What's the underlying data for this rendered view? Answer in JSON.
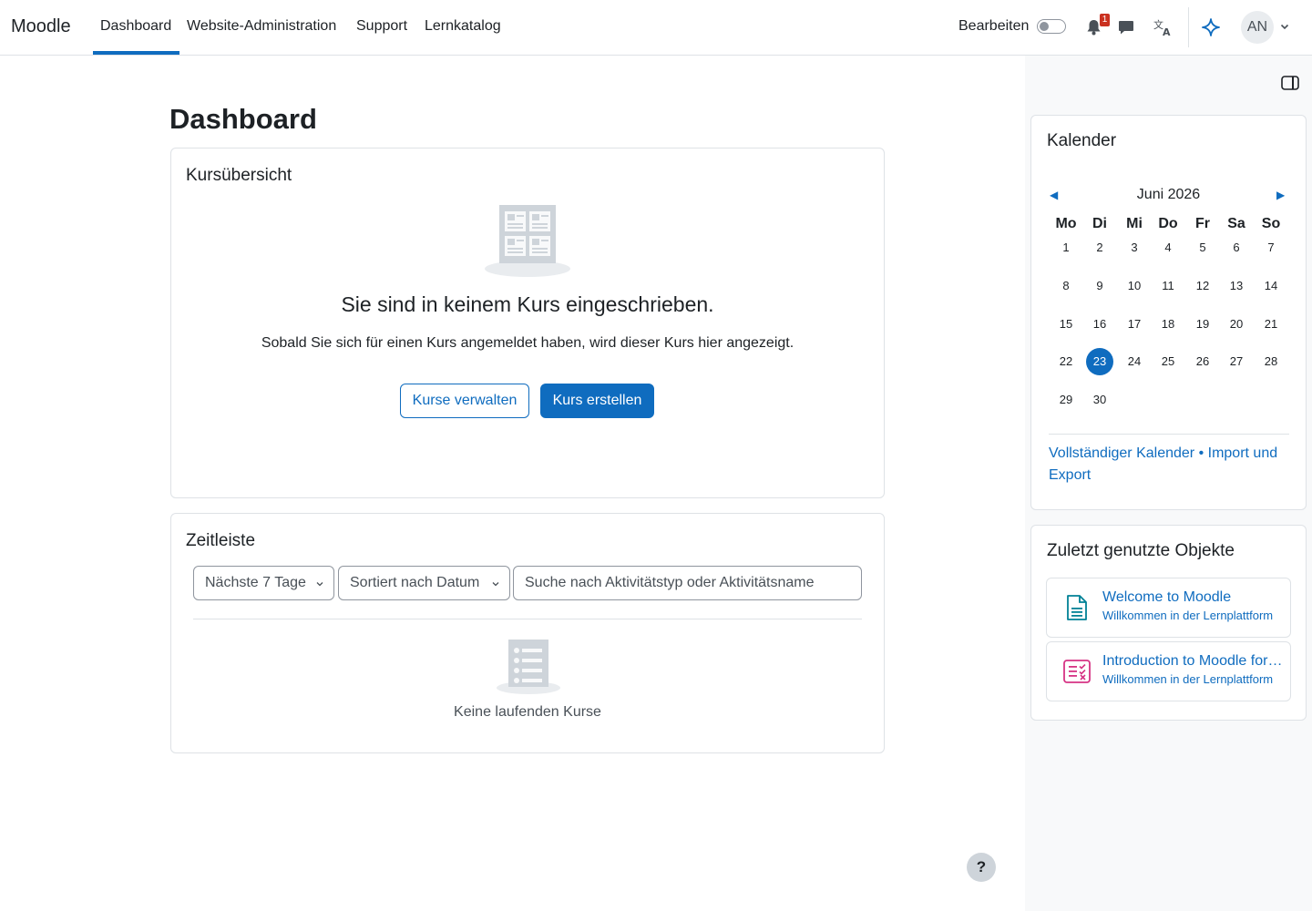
{
  "navbar": {
    "brand": "Moodle",
    "items": [
      {
        "label": "Dashboard",
        "active": true
      },
      {
        "label": "Website-Administration"
      },
      {
        "label": "Support"
      },
      {
        "label": "Lernkatalog"
      }
    ],
    "edit_label": "Bearbeiten",
    "notification_count": "1",
    "avatar_initials": "AN",
    "icons": [
      "bell-icon",
      "chat-icon",
      "translate-icon",
      "sparkle-icon"
    ]
  },
  "page": {
    "title": "Dashboard"
  },
  "course_overview": {
    "title": "Kursübersicht",
    "empty_heading": "Sie sind in keinem Kurs eingeschrieben.",
    "empty_text": "Sobald Sie sich für einen Kurs angemeldet haben, wird dieser Kurs hier angezeigt.",
    "manage_button": "Kurse verwalten",
    "create_button": "Kurs erstellen"
  },
  "timeline": {
    "title": "Zeitleiste",
    "filter_value": "Nächste 7 Tage",
    "sort_value": "Sortiert nach Datum",
    "search_placeholder": "Suche nach Aktivitätstyp oder Aktivitätsname",
    "empty_text": "Keine laufenden Kurse"
  },
  "calendar": {
    "title": "Kalender",
    "month": "Juni 2026",
    "weekdays": [
      "Mo",
      "Di",
      "Mi",
      "Do",
      "Fr",
      "Sa",
      "So"
    ],
    "weeks": [
      [
        "1",
        "2",
        "3",
        "4",
        "5",
        "6",
        "7"
      ],
      [
        "8",
        "9",
        "10",
        "11",
        "12",
        "13",
        "14"
      ],
      [
        "15",
        "16",
        "17",
        "18",
        "19",
        "20",
        "21"
      ],
      [
        "22",
        "23",
        "24",
        "25",
        "26",
        "27",
        "28"
      ],
      [
        "29",
        "30"
      ]
    ],
    "today": "23",
    "link_full": "Vollständiger Kalender",
    "link_separator": "•",
    "link_import": "Import und Export"
  },
  "recent_items": {
    "title": "Zuletzt genutzte Objekte",
    "items": [
      {
        "title": "Welcome to Moodle",
        "subtitle": "Willkommen in der Lernplattform",
        "icon": "page-icon",
        "color": "#008196"
      },
      {
        "title": "Introduction to Moodle for learners",
        "subtitle": "Willkommen in der Lernplattform",
        "icon": "assignment-icon",
        "color": "#d63384"
      }
    ]
  },
  "help": {
    "label": "?"
  },
  "colors": {
    "primary": "#0f6cbf",
    "drawer_bg": "#f8f9fa",
    "badge": "#ca3120"
  }
}
